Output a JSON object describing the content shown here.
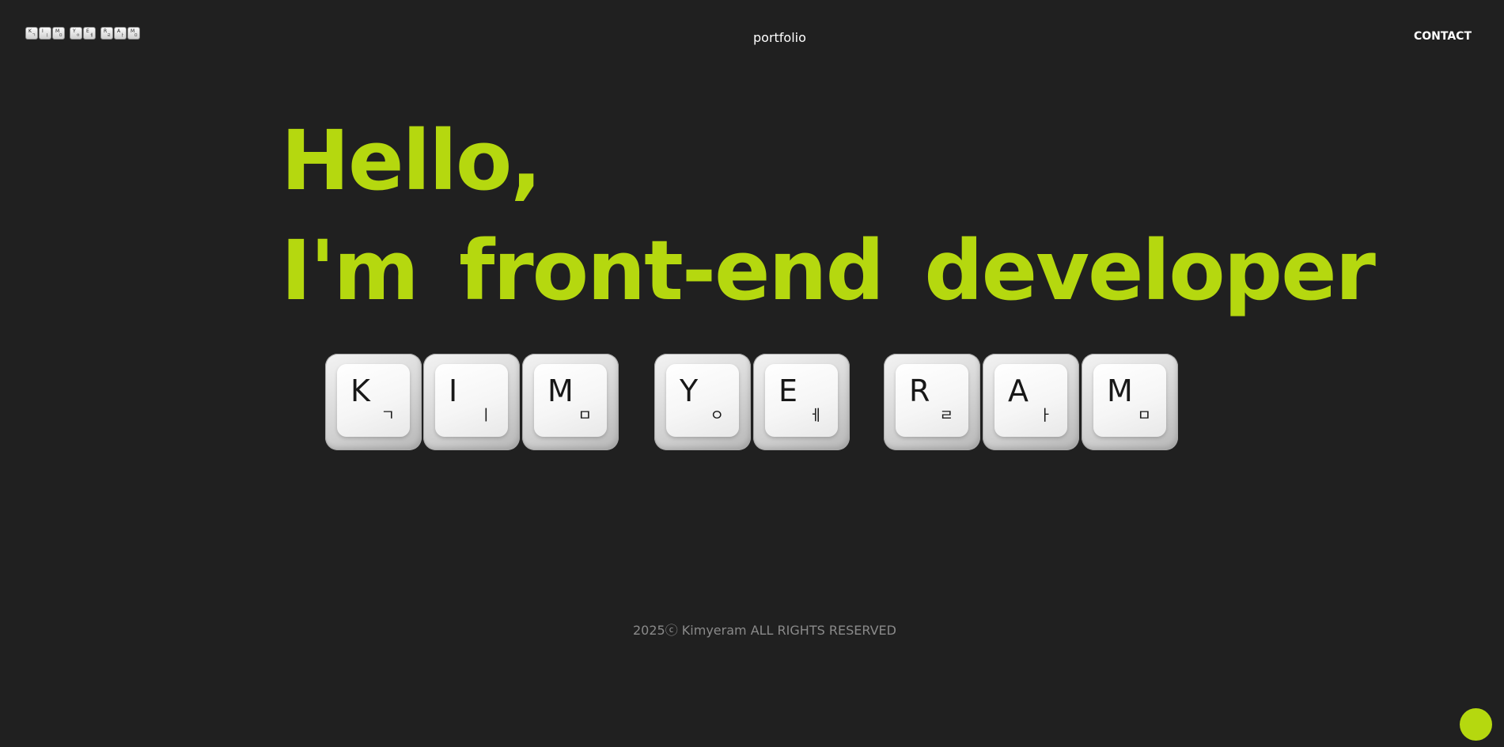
{
  "header": {
    "logo": {
      "groups": [
        [
          {
            "en": "K",
            "ko": "ㄱ"
          },
          {
            "en": "I",
            "ko": "ㅣ"
          },
          {
            "en": "M",
            "ko": "ㅁ"
          }
        ],
        [
          {
            "en": "Y",
            "ko": "ㅇ"
          },
          {
            "en": "E",
            "ko": "ㅔ"
          }
        ],
        [
          {
            "en": "R",
            "ko": "ㄹ"
          },
          {
            "en": "A",
            "ko": "ㅏ"
          },
          {
            "en": "M",
            "ko": "ㅁ"
          }
        ]
      ]
    },
    "nav_center": "portfolio",
    "nav_right": "CONTACT"
  },
  "hero": {
    "line1": "Hello,",
    "line2": "I'm front-end developer",
    "accent_color": "#b5d80f"
  },
  "keycaps": [
    {
      "en": "K",
      "ko": "ㄱ"
    },
    {
      "en": "I",
      "ko": "ㅣ"
    },
    {
      "en": "M",
      "ko": "ㅁ"
    },
    {
      "en": "Y",
      "ko": "ㅇ"
    },
    {
      "en": "E",
      "ko": "ㅔ"
    },
    {
      "en": "R",
      "ko": "ㄹ"
    },
    {
      "en": "A",
      "ko": "ㅏ"
    },
    {
      "en": "M",
      "ko": "ㅁ"
    }
  ],
  "footer": {
    "copyright": "2025ⓒ Kimyeram ALL RIGHTS RESERVED"
  },
  "colors": {
    "background": "#202020",
    "accent": "#b5d80f",
    "text": "#ffffff",
    "muted": "#8a8a8a"
  }
}
